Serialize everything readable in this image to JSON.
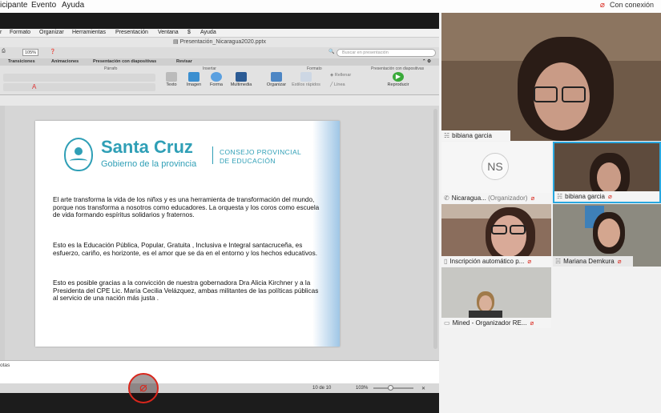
{
  "top_menu": {
    "items": [
      "icipante",
      "Evento",
      "Ayuda"
    ],
    "connection": "Con conexión"
  },
  "ppt": {
    "menu": [
      "r",
      "Formato",
      "Organizar",
      "Herramientas",
      "Presentación",
      "Ventana",
      "Ayuda"
    ],
    "filename": "Presentación_Nicaragua2020.pptx",
    "zoom": "105%",
    "search_placeholder": "Buscar en presentación",
    "tabs": [
      "Transiciones",
      "Animaciones",
      "Presentación con diapositivas",
      "Revisar"
    ],
    "groups": [
      "Párrafo",
      "Insertar",
      "Formato",
      "Presentación con diapositivas"
    ],
    "buttons": [
      "Texto",
      "Imagen",
      "Forma",
      "Multimedia",
      "Organizar",
      "Estilos rápidos",
      "Rellenar",
      "Línea",
      "Reproducir"
    ],
    "notes_label": "otas",
    "slide_count": "10 de 10",
    "status_zoom": "103%"
  },
  "slide": {
    "brand": "Santa Cruz",
    "brand_sub": "Gobierno de la provincia",
    "council_line1": "CONSEJO PROVINCIAL",
    "council_line2": "DE EDUCACIÓN",
    "para1": "El arte transforma la vida de los niñxs y es una herramienta de transformación del mundo, porque nos transforma a nosotros como educadores. La orquesta y los coros como escuela de vida formando espíritus solidarios y fraternos.",
    "para2": "Esto es la Educación Pública, Popular, Gratuita ,  Inclusiva e Integral santacruceña, es esfuerzo, cariño, es horizonte, es el amor que se da en el entorno y los hechos educativos.",
    "para3": "Esto es posible gracias a la convicción de nuestra gobernadora Dra Alicia Kirchner y a la Presidenta del CPE Lic. María Cecilia Velázquez, ambas militantes de las políticas públicas al servicio de una nación más justa ."
  },
  "participants": {
    "main": "bibiana garcia",
    "t1_name": "Nicaragua...",
    "t1_role": "(Organizador)",
    "t1_initials": "NS",
    "t2_name": "bibiana garcia",
    "t3_name": "Inscripción automático p...",
    "t4_name": "Mariana Demkura",
    "t5_name": "Mined - Organizador RE..."
  },
  "colors": {
    "brand": "#2f9fb6",
    "mic_muted": "#d9261c",
    "active_border": "#29a8e0"
  }
}
